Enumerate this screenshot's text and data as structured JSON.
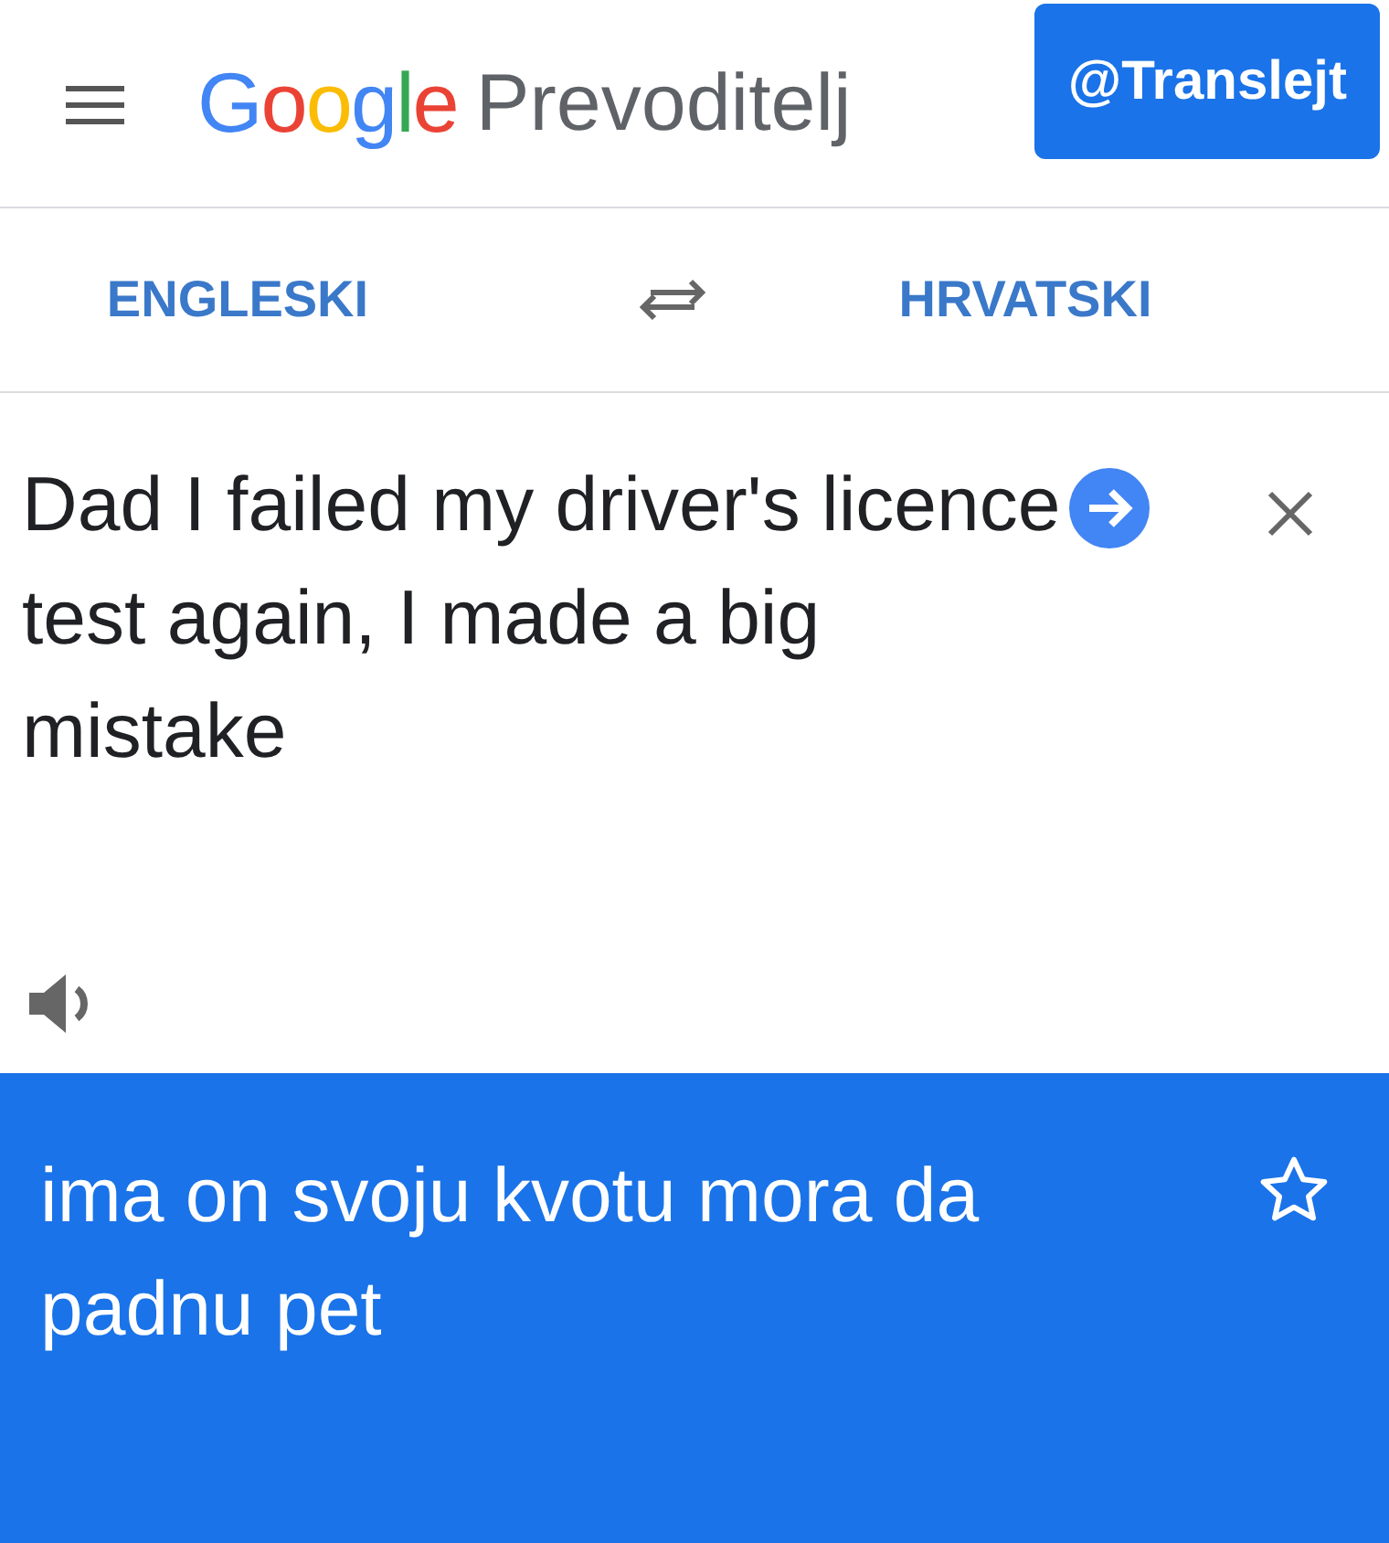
{
  "header": {
    "logo": "Google",
    "product": "Prevoditelj",
    "badge": "@Translejt"
  },
  "languages": {
    "source": "ENGLESKI",
    "target": "HRVATSKI"
  },
  "input": {
    "value": "Dad I failed my driver's licence test again, I made a big mistake"
  },
  "output": {
    "text": "ima on svoju kvotu mora da padnu pet",
    "starred": false
  }
}
